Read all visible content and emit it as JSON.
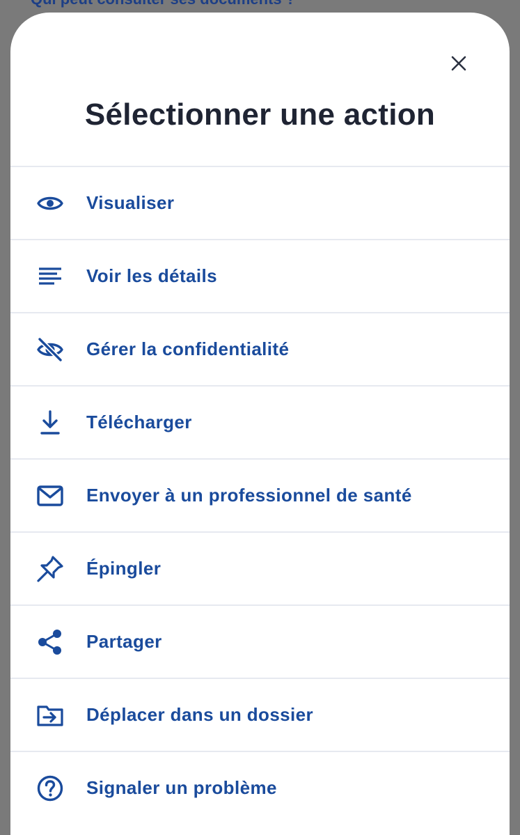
{
  "background": {
    "peek_text": "Qui peut consulter ses documents ?"
  },
  "sheet": {
    "title": "Sélectionner une action",
    "close_icon": "close-icon"
  },
  "actions": [
    {
      "label": "Visualiser",
      "icon": "eye-icon"
    },
    {
      "label": "Voir les détails",
      "icon": "lines-icon"
    },
    {
      "label": "Gérer la confidentialité",
      "icon": "eye-off-icon"
    },
    {
      "label": "Télécharger",
      "icon": "download-icon"
    },
    {
      "label": "Envoyer à un professionnel de santé",
      "icon": "mail-icon"
    },
    {
      "label": "Épingler",
      "icon": "pin-icon"
    },
    {
      "label": "Partager",
      "icon": "share-icon"
    },
    {
      "label": "Déplacer dans un dossier",
      "icon": "folder-move-icon"
    },
    {
      "label": "Signaler un problème",
      "icon": "help-circle-icon"
    }
  ],
  "colors": {
    "accent": "#1a4b9c",
    "title": "#1f2433",
    "overlay": "#7a7a7a",
    "divider": "#e6e9f0"
  }
}
